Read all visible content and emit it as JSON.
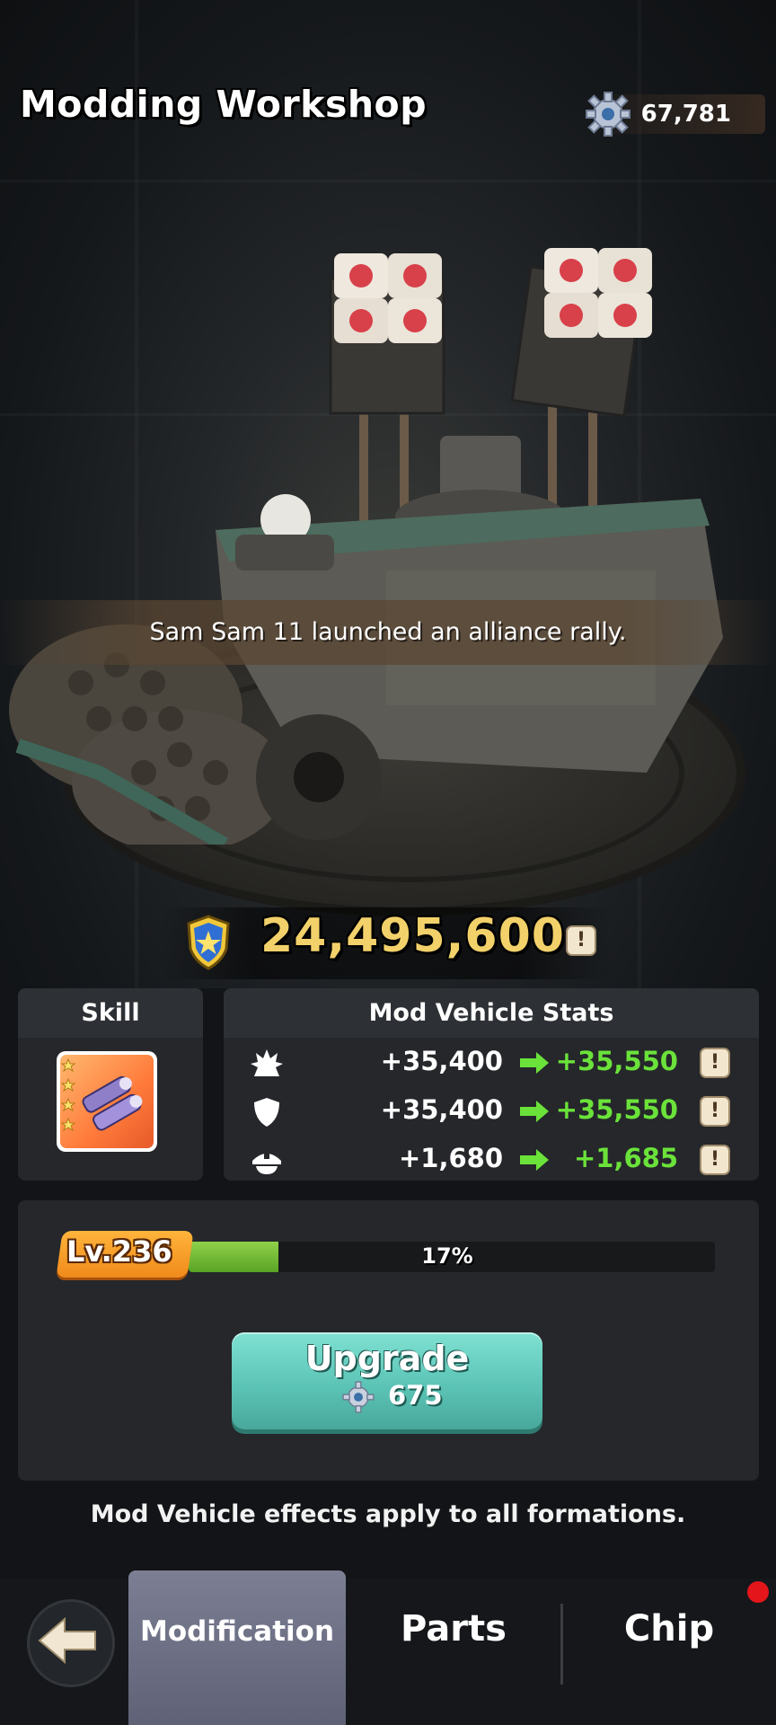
{
  "header": {
    "title": "Modding Workshop",
    "currency_value": "67,781",
    "currency_icon": "gear-icon"
  },
  "scene": {
    "notification": "Sam Sam 11 launched an alliance rally."
  },
  "power": {
    "value": "24,495,600",
    "icon": "shield-star-icon",
    "info_label": "!"
  },
  "skill_panel": {
    "title": "Skill",
    "skill_icon": "missile-launcher-icon",
    "stars": 4
  },
  "stats_panel": {
    "title": "Mod Vehicle Stats",
    "rows": [
      {
        "icon": "attack-icon",
        "current": "+35,400",
        "next": "+35,550",
        "info": "!"
      },
      {
        "icon": "defense-icon",
        "current": "+35,400",
        "next": "+35,550",
        "info": "!"
      },
      {
        "icon": "hp-cap-icon",
        "current": "+1,680",
        "next": "+1,685",
        "info": "!"
      }
    ]
  },
  "level": {
    "label": "Lv.236",
    "progress_text": "17%",
    "progress": 0.17
  },
  "upgrade": {
    "label": "Upgrade",
    "cost": "675",
    "cost_icon": "gear-icon"
  },
  "footer_note": "Mod Vehicle effects apply to all formations.",
  "nav": {
    "back_icon": "arrow-left-icon",
    "tabs": [
      {
        "label": "Modification",
        "active": true
      },
      {
        "label": "Parts",
        "active": false
      },
      {
        "label": "Chip",
        "active": false,
        "badge": true
      }
    ]
  },
  "colors": {
    "power_gold": "#f3d16a",
    "stat_green": "#6be23a",
    "level_orange": "#f08a1a",
    "progress_green": "#5aa325",
    "upgrade_teal": "#5cc4b6",
    "tab_active": "#6e7185",
    "badge_red": "#e4151b"
  }
}
